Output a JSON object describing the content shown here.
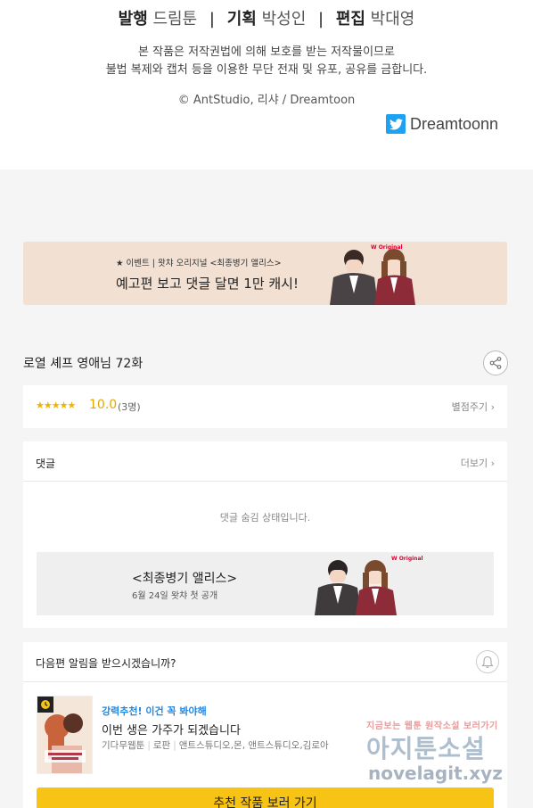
{
  "credits": {
    "publisher_role": "발행",
    "publisher_name": "드림툰",
    "planner_role": "기획",
    "planner_name": "박성인",
    "editor_role": "편집",
    "editor_name": "박대영",
    "separator": "|",
    "notice_line1": "본 작품은 저작권법에 의해 보호를 받는 저작물이므로",
    "notice_line2": "불법 복제와 캡처 등을 이용한 무단 전재 및 유포, 공유를 금합니다.",
    "copyright": "© AntStudio, 리샤 / Dreamtoon",
    "twitter_handle": "Dreamtoonn"
  },
  "banner": {
    "subtitle": "★ 이벤트 | 왓챠 오리지널 <최종병기 앨리스>",
    "main": "예고편 보고 댓글 달면 1만 캐시!",
    "brand": "W Original"
  },
  "episode": {
    "title": "로열 셰프 영애님 72화"
  },
  "rating": {
    "stars": "★★★★★",
    "score": "10.0",
    "count": "(3명)",
    "rate_link": "별점주기"
  },
  "comments": {
    "title": "댓글",
    "more": "더보기",
    "hidden_message": "댓글 숨김 상태입니다.",
    "promo_title": "<최종병기 앨리스>",
    "promo_date": "6월 24일 왓챠 첫 공개",
    "promo_brand": "W Original"
  },
  "notify": {
    "question": "다음편 알림을 받으시겠습니까?",
    "rec_label": "강력추천! 이건 꼭 봐야해",
    "rec_title": "이번 생은 가주가 되겠습니다",
    "rec_tags": [
      "기다무웹툰",
      "로판",
      "앤트스튜디오,몬, 앤트스튜디오,김로아"
    ],
    "button_label": "추천 작품 보러 가기"
  },
  "watermark": {
    "small": "지금보는 웹툰 원작소설 보러가기",
    "big": "아지툰소설",
    "url": "novelagit.xyz"
  },
  "colors": {
    "accent_yellow": "#f7c315",
    "star": "#f2b200",
    "link_blue": "#1e88e5",
    "twitter": "#1da1f2"
  }
}
